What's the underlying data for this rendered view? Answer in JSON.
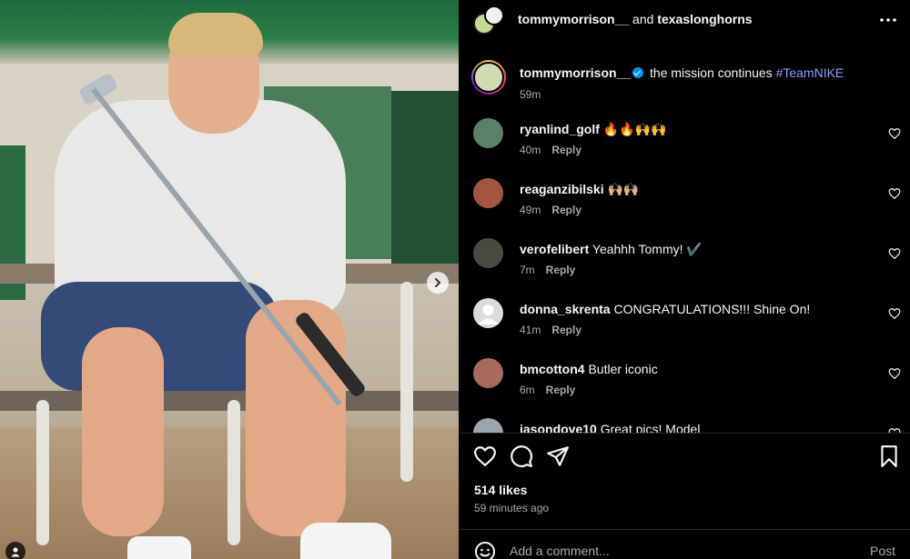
{
  "header": {
    "user1": "tommymorrison__",
    "conjunction": "and",
    "user2": "texaslonghorns",
    "more_icon": "more-horizontal-icon"
  },
  "caption": {
    "username": "tommymorrison__",
    "verified": true,
    "text": "the mission continues",
    "hashtag": "#TeamNIKE",
    "time": "59m"
  },
  "comments": [
    {
      "username": "ryanlind_golf",
      "text": "🔥🔥🙌🙌",
      "time": "40m",
      "reply": "Reply",
      "avatar_color": "#5b7f6a"
    },
    {
      "username": "reaganzibilski",
      "text": "🙌🏼🙌🏼",
      "time": "49m",
      "reply": "Reply",
      "avatar_color": "#a4553f"
    },
    {
      "username": "verofelibert",
      "text": "Yeahhh Tommy! ✔️",
      "time": "7m",
      "reply": "Reply",
      "avatar_color": "#4a4a40"
    },
    {
      "username": "donna_skrenta",
      "text": "CONGRATULATIONS!!! Shine On!",
      "time": "41m",
      "reply": "Reply",
      "avatar_color": "#dbdbdb"
    },
    {
      "username": "bmcotton4",
      "text": "Butler iconic",
      "time": "6m",
      "reply": "Reply",
      "avatar_color": "#a86a5e"
    },
    {
      "username": "jasondove10",
      "text": "Great pics! Model",
      "time": "",
      "reply": "",
      "avatar_color": "#9aa5ad"
    }
  ],
  "actions": {
    "like_icon": "heart-icon",
    "comment_icon": "comment-icon",
    "share_icon": "share-icon",
    "save_icon": "bookmark-icon"
  },
  "likes": "514 likes",
  "posted_ago": "59 minutes ago",
  "comment_box": {
    "placeholder": "Add a comment...",
    "post_label": "Post"
  },
  "colors": {
    "background": "#000000",
    "text": "#f5f5f5",
    "muted": "#a8a8a8",
    "hashtag": "#8f9cff",
    "verified": "#0095f6"
  }
}
